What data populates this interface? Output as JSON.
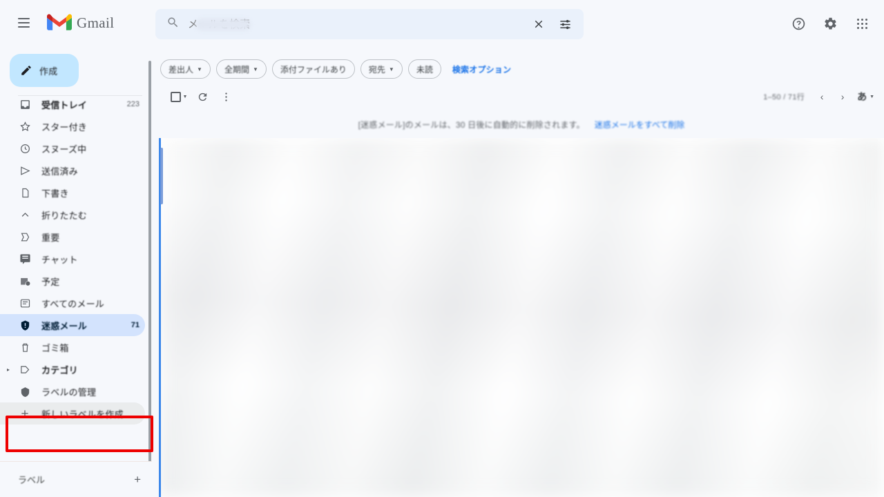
{
  "app": {
    "brand_name": "Gmail",
    "logo_colors": {
      "red": "#ea4335",
      "yellow": "#fbbc04",
      "green": "#34a853",
      "blue": "#4285f4",
      "dark_red": "#c5221f"
    },
    "accent_blue": "#1a73e8",
    "highlight_box_color": "#ee0000",
    "active_item_bg": "#d3e3fd",
    "compose_bg": "#c2e7ff",
    "search_bg": "#eaf1fb",
    "page_bg": "#f6f8fc"
  },
  "topbar": {
    "menu_icon": "hamburger-menu-icon",
    "help_icon": "help-icon",
    "settings_icon": "gear-icon",
    "apps_icon": "apps-grid-icon"
  },
  "search": {
    "icon": "search-icon",
    "value": "",
    "placeholder": "メールを検索",
    "clear_icon": "close-icon",
    "options_icon": "search-options-icon"
  },
  "sidebar": {
    "compose": {
      "label": "作成",
      "icon": "pencil-icon"
    },
    "items": [
      {
        "label": "受信トレイ",
        "icon": "inbox-icon",
        "count": "223",
        "state": "bold"
      },
      {
        "label": "スター付き",
        "icon": "star-icon",
        "count": "",
        "state": "normal"
      },
      {
        "label": "スヌーズ中",
        "icon": "clock-icon",
        "count": "",
        "state": "normal"
      },
      {
        "label": "送信済み",
        "icon": "send-icon",
        "count": "",
        "state": "normal"
      },
      {
        "label": "下書き",
        "icon": "draft-icon",
        "count": "",
        "state": "normal"
      },
      {
        "label": "折りたたむ",
        "icon": "chevron-up-icon",
        "count": "",
        "state": "normal"
      },
      {
        "label": "重要",
        "icon": "important-icon",
        "count": "",
        "state": "normal"
      },
      {
        "label": "チャット",
        "icon": "chat-icon",
        "count": "",
        "state": "normal"
      },
      {
        "label": "予定",
        "icon": "scheduled-icon",
        "count": "",
        "state": "normal"
      },
      {
        "label": "すべてのメール",
        "icon": "all-mail-icon",
        "count": "",
        "state": "normal"
      },
      {
        "label": "迷惑メール",
        "icon": "spam-icon",
        "count": "71",
        "state": "active"
      },
      {
        "label": "ゴミ箱",
        "icon": "trash-icon",
        "count": "",
        "state": "normal"
      },
      {
        "label": "カテゴリ",
        "icon": "category-icon",
        "count": "",
        "state": "bold",
        "expandable": true
      },
      {
        "label": "ラベルの管理",
        "icon": "manage-labels-icon",
        "count": "",
        "state": "normal"
      },
      {
        "label": "新しいラベルを作成",
        "icon": "plus-icon",
        "count": "",
        "state": "hovered",
        "highlighted": true
      }
    ],
    "labels_footer": {
      "label": "ラベル",
      "add_icon": "plus-icon"
    }
  },
  "filters": {
    "chips": [
      {
        "label": "差出人",
        "dropdown": true
      },
      {
        "label": "全期間",
        "dropdown": true
      },
      {
        "label": "添付ファイルあり",
        "dropdown": false
      },
      {
        "label": "宛先",
        "dropdown": true
      },
      {
        "label": "未読",
        "dropdown": false
      }
    ],
    "search_options_link": "検索オプション"
  },
  "list_toolbar": {
    "select_all": {
      "icon": "checkbox-icon",
      "dropdown_icon": "chevron-down-icon"
    },
    "refresh_icon": "refresh-icon",
    "more_icon": "more-vertical-icon",
    "pagination": "1–50 / 71行",
    "prev_icon": "chevron-left-icon",
    "next_icon": "chevron-right-icon",
    "language": {
      "label": "あ",
      "dropdown_icon": "chevron-down-icon"
    }
  },
  "banner": {
    "message": "[迷惑メール]のメールは、30 日後に自動的に削除されます。",
    "action_link": "迷惑メールをすべて削除"
  },
  "mail_list": {
    "status": "content-obscured",
    "visible_rows": []
  }
}
